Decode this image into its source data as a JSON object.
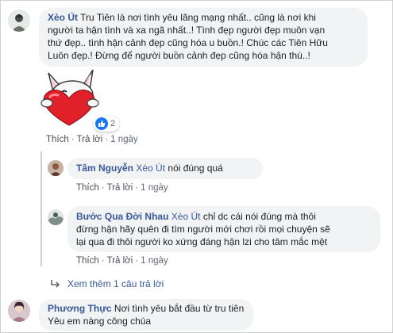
{
  "comment1": {
    "author": "Xèo Út",
    "text_lines": [
      "Tru Tiên là nơi tình yêu lãng mạng nhất.. cũng là nơi khi",
      "người ta hận tình và xa ngã nhất..! Tình đẹp người đẹp muôn vạn",
      "thứ đẹp.. tình hận cảnh đẹp cũng hóa u buồn.! Chúc các Tiên Hữu",
      "Luôn đẹp.! Đừng để người buồn cảnh đẹp cũng hóa hận thù..!"
    ],
    "reaction_count": "2",
    "sticker_icon": "bunny-heart-sticker",
    "like_label": "Thích",
    "reply_label": "Trả lời",
    "time": "1 ngày"
  },
  "reply1": {
    "author": "Tâm Nguyễn",
    "tag": "Xèo Út",
    "text": "nói đúng quá",
    "like_label": "Thích",
    "reply_label": "Trả lời",
    "time": "1 ngày"
  },
  "reply2": {
    "author": "Bước Qua Đời Nhau",
    "tag": "Xèo Út",
    "text_first": "chỉ dc cái nói đúng mà thôi",
    "text_lines": [
      "đừng hận hãy quên đi tìm người mới chơi rồi mọi chuyện sẽ",
      "lại qua đi thôi người ko xứng đáng hận lzi cho tâm mắc mệt"
    ],
    "like_label": "Thích",
    "reply_label": "Trả lời",
    "time": "1 ngày"
  },
  "more_replies": {
    "label": "Xem thêm 1 câu trả lời",
    "icon": "reply-arrow-icon"
  },
  "comment2": {
    "author": "Phương Thực",
    "text_first": "Nơi tình yêu bắt đầu từ tru tiên",
    "text_second": "Yêu em nàng công chúa"
  },
  "colors": {
    "link": "#385898",
    "bubble": "#f2f3f5",
    "like_blue": "#1877f2",
    "sticker_red": "#e0212a"
  }
}
